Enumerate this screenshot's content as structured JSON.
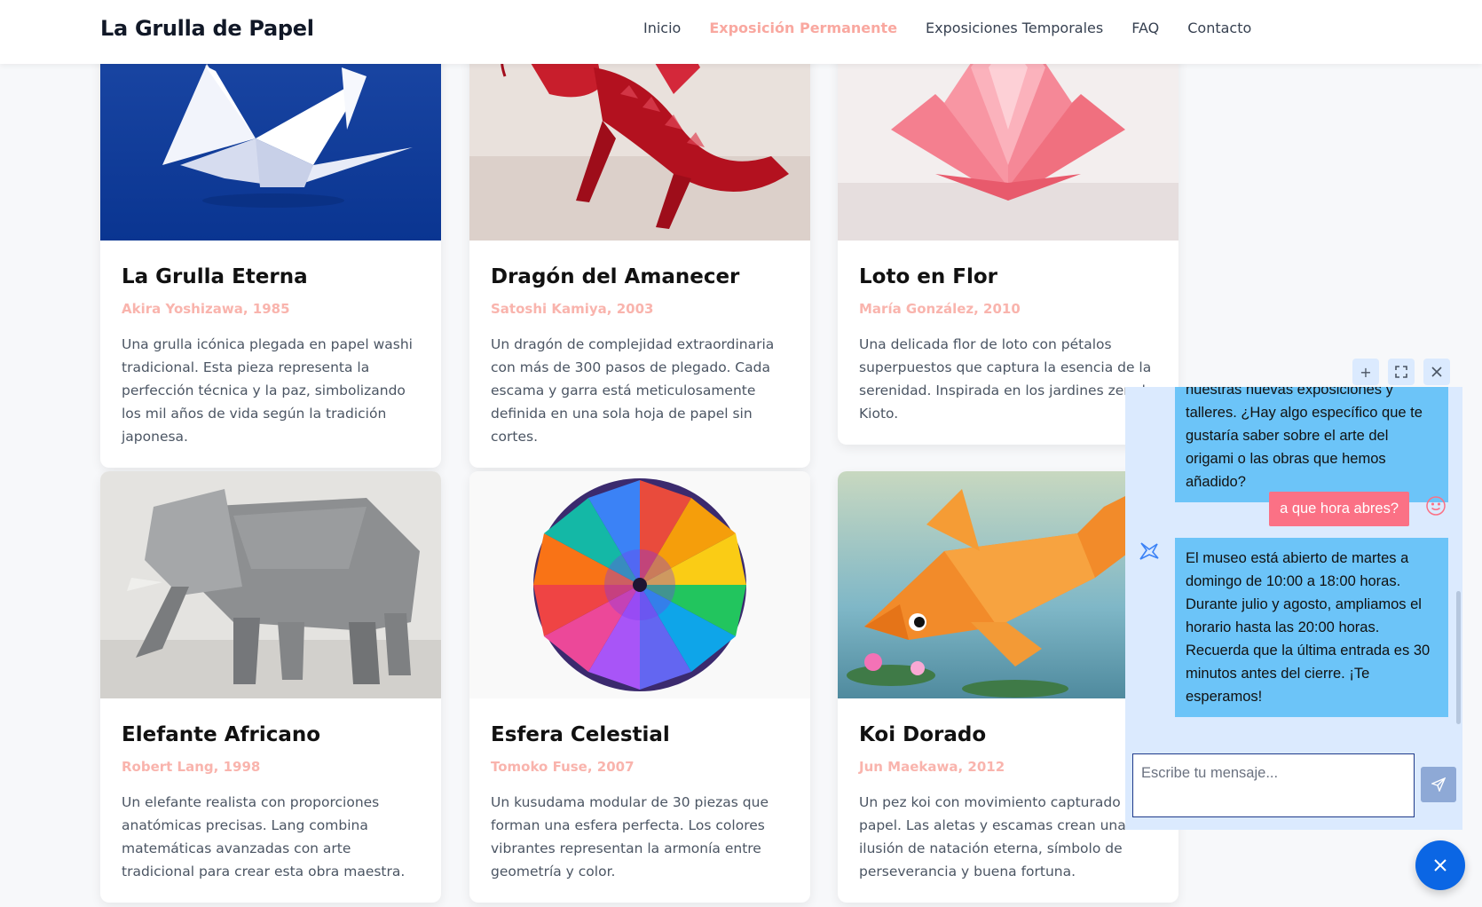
{
  "header": {
    "brand": "La Grulla de Papel",
    "nav": [
      "Inicio",
      "Exposición Permanente",
      "Exposiciones Temporales",
      "FAQ",
      "Contacto"
    ],
    "active_index": 1
  },
  "cards": [
    {
      "title": "La Grulla Eterna",
      "author": "Akira Yoshizawa, 1985",
      "desc": "Una grulla icónica plegada en papel washi tradicional. Esta pieza representa la perfección técnica y la paz, simbolizando los mil años de vida según la tradición japonesa.",
      "image": "white-origami-crane-on-blue"
    },
    {
      "title": "Dragón del Amanecer",
      "author": "Satoshi Kamiya, 2003",
      "desc": "Un dragón de complejidad extraordinaria con más de 300 pasos de plegado. Cada escama y garra está meticulosamente definida en una sola hoja de papel sin cortes.",
      "image": "red-origami-dragon"
    },
    {
      "title": "Loto en Flor",
      "author": "María González, 2010",
      "desc": "Una delicada flor de loto con pétalos superpuestos que captura la esencia de la serenidad. Inspirada en los jardines zen de Kioto.",
      "image": "pink-origami-lotus"
    },
    {
      "title": "Elefante Africano",
      "author": "Robert Lang, 1998",
      "desc": "Un elefante realista con proporciones anatómicas precisas. Lang combina matemáticas avanzadas con arte tradicional para crear esta obra maestra.",
      "image": "grey-origami-elephant"
    },
    {
      "title": "Esfera Celestial",
      "author": "Tomoko Fuse, 2007",
      "desc": "Un kusudama modular de 30 piezas que forman una esfera perfecta. Los colores vibrantes representan la armonía entre geometría y color.",
      "image": "rainbow-kusudama-sphere"
    },
    {
      "title": "Koi Dorado",
      "author": "Jun Maekawa, 2012",
      "desc": "Un pez koi con movimiento capturado en papel. Las aletas y escamas crean una ilusión de natación eterna, símbolo de perseverancia y buena fortuna.",
      "image": "orange-origami-koi"
    }
  ],
  "chat": {
    "controls": [
      "plus-icon",
      "expand-icon",
      "close-icon"
    ],
    "messages": [
      {
        "from": "bot",
        "text": "nuestras nuevas exposiciones y talleres. ¿Hay algo específico que te gustaría saber sobre el arte del origami o las obras que hemos añadido?"
      },
      {
        "from": "user",
        "text": "a que hora abres?"
      },
      {
        "from": "bot",
        "text": "El museo está abierto de martes a domingo de 10:00 a 18:00 horas. Durante julio y agosto, ampliamos el horario hasta las 20:00 horas. Recuerda que la última entrada es 30 minutos antes del cierre. ¡Te esperamos!"
      }
    ],
    "input_placeholder": "Escribe tu mensaje..."
  },
  "colors": {
    "accent": "#f9a8a0",
    "bot_bubble": "#6cc4f8",
    "user_bubble": "#fb7185",
    "fab": "#0b66e4"
  }
}
